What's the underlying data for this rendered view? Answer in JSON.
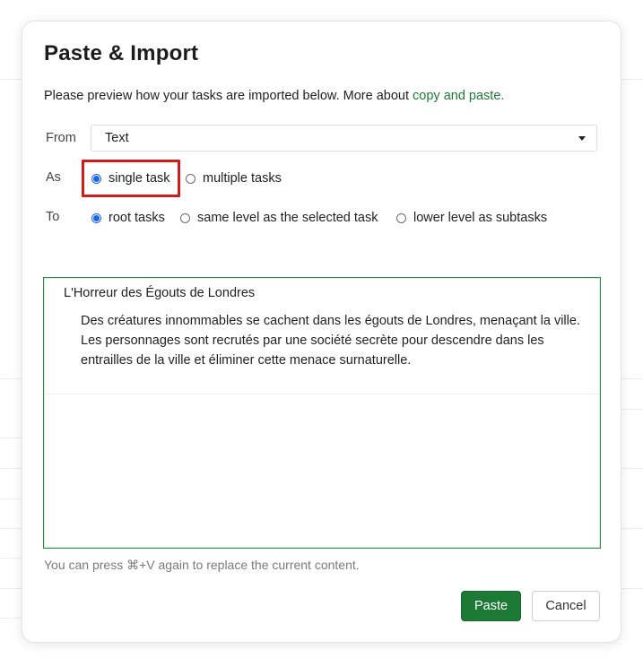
{
  "dialog": {
    "title": "Paste & Import",
    "intro_text": "Please preview how your tasks are imported below. More about ",
    "intro_link": "copy and paste."
  },
  "from": {
    "label": "From",
    "selected": "Text",
    "icon": "chevron-down-icon"
  },
  "as": {
    "label": "As",
    "options": [
      {
        "label": "single task",
        "checked": true
      },
      {
        "label": "multiple tasks",
        "checked": false
      }
    ]
  },
  "to": {
    "label": "To",
    "options": [
      {
        "label": "root tasks",
        "checked": true
      },
      {
        "label": "same level as the selected task",
        "checked": false
      },
      {
        "label": "lower level as subtasks",
        "checked": false
      }
    ]
  },
  "preview": {
    "task_title": "L'Horreur des Égouts de Londres",
    "task_notes": "Des créatures innommables se cachent dans les égouts de Londres, menaçant la ville. Les personnages sont recrutés par une société secrète pour descendre dans les entrailles de la ville et éliminer cette menace surnaturelle."
  },
  "hint": "You can press ⌘+V again to replace the current content.",
  "buttons": {
    "paste": "Paste",
    "cancel": "Cancel"
  },
  "colors": {
    "accent_green": "#1c7a35",
    "radio_blue": "#1a63f0",
    "highlight_red": "#cc1d1d"
  }
}
